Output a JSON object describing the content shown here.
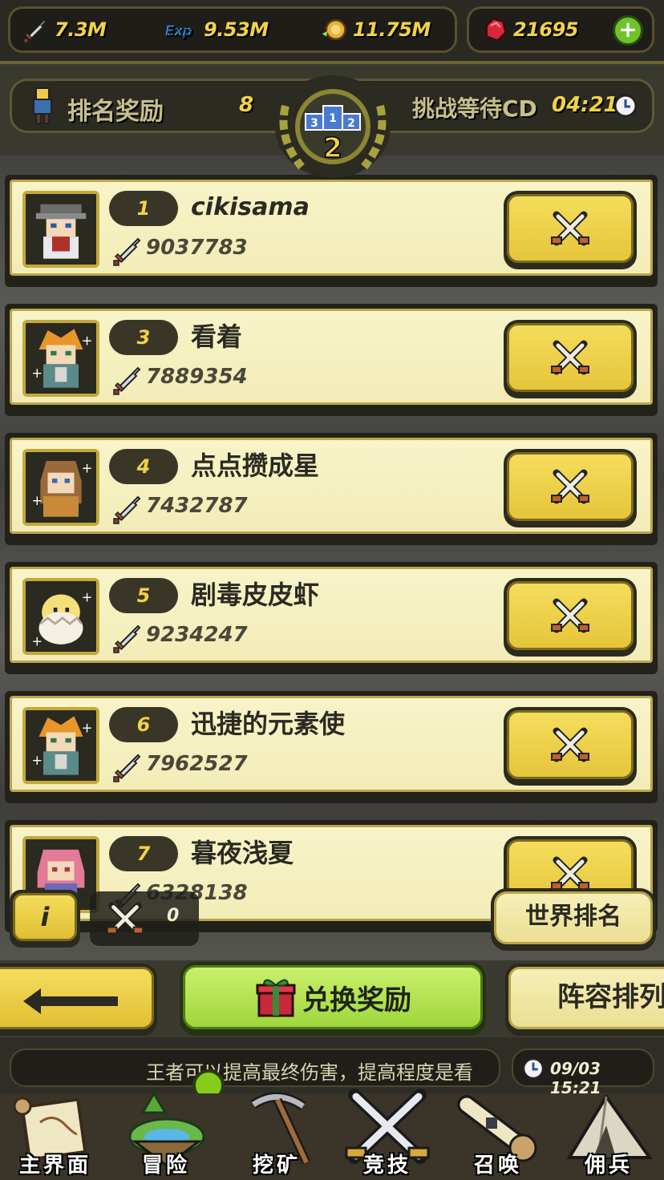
{
  "resources": {
    "attack": "7.3M",
    "exp": "9.53M",
    "coins": "11.75M",
    "gems": "21695",
    "exp_icon_text": "Exp",
    "add_label": "+"
  },
  "header": {
    "rank_reward_label": "排名奖励",
    "rank_reward_value": "8",
    "challenge_cd_label": "挑战等待CD",
    "challenge_cd_value": "04:21",
    "emblem_rank": "2",
    "podium": [
      "3",
      "1",
      "2"
    ]
  },
  "players": [
    {
      "rank": "1",
      "name": "cikisama",
      "power": "9037783",
      "latin": true
    },
    {
      "rank": "3",
      "name": "看着",
      "power": "7889354"
    },
    {
      "rank": "4",
      "name": "点点攒成星",
      "power": "7432787"
    },
    {
      "rank": "5",
      "name": "剧毒皮皮虾",
      "power": "9234247"
    },
    {
      "rank": "6",
      "name": "迅捷的元素使",
      "power": "7962527"
    },
    {
      "rank": "7",
      "name": "暮夜浅夏",
      "power": "6328138"
    }
  ],
  "controls": {
    "info_label": "i",
    "tickets_count": "0",
    "world_rank_label": "世界排名",
    "redeem_label": "兑换奖励",
    "lineup_label": "阵容排列"
  },
  "ticker": {
    "message": "王者可以提高最终伤害，提高程度是看",
    "datetime": "09/03 15:21"
  },
  "nav": [
    {
      "label": "主界面",
      "icon": "map-scroll-icon"
    },
    {
      "label": "冒险",
      "icon": "floating-island-icon"
    },
    {
      "label": "挖矿",
      "icon": "pickaxe-icon"
    },
    {
      "label": "竞技",
      "icon": "crossed-swords-icon"
    },
    {
      "label": "召唤",
      "icon": "summon-scroll-icon"
    },
    {
      "label": "佣兵",
      "icon": "tent-icon"
    }
  ],
  "colors": {
    "gold_text": "#f2d24a",
    "row_bg": "#f2ecb7",
    "button_yellow": "#e6c53a",
    "button_green": "#9fd63c"
  }
}
